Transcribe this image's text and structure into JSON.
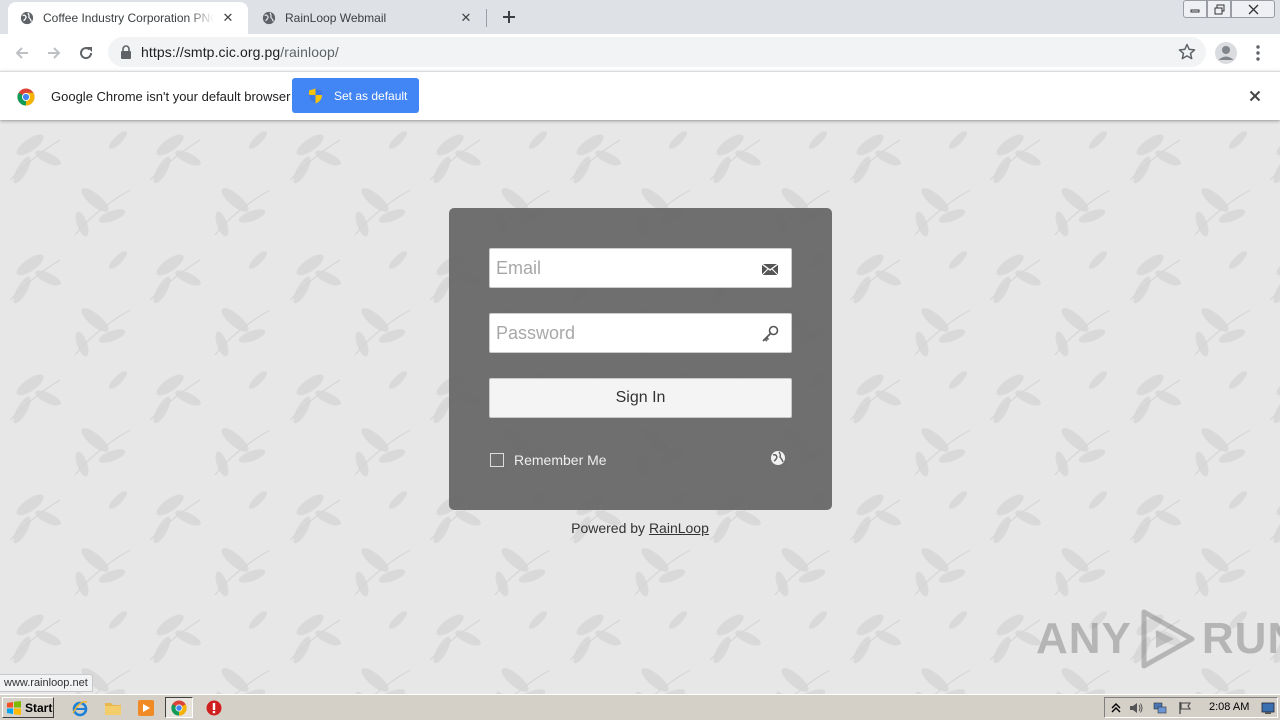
{
  "browser": {
    "tabs": [
      {
        "title": "Coffee Industry Corporation PNG Webmail",
        "active": true
      },
      {
        "title": "RainLoop Webmail",
        "active": false
      }
    ],
    "url": {
      "scheme": "https://",
      "host": "smtp.cic.org.pg",
      "path": "/rainloop/"
    },
    "infobar": {
      "message": "Google Chrome isn't your default browser",
      "button_label": "Set as default"
    },
    "status_url": "www.rainloop.net"
  },
  "login": {
    "email_placeholder": "Email",
    "password_placeholder": "Password",
    "signin_label": "Sign In",
    "remember_label": "Remember Me",
    "remember_checked": false,
    "powered_by_prefix": "Powered by ",
    "powered_by_link": "RainLoop"
  },
  "watermark": {
    "left": "ANY",
    "right": "RUN"
  },
  "taskbar": {
    "start_label": "Start",
    "clock": "2:08 AM"
  },
  "colors": {
    "accent": "#4285f4",
    "panel": "#5f5f5f",
    "page_background": "#e6e6e6",
    "taskbar": "#d4d0c8"
  }
}
